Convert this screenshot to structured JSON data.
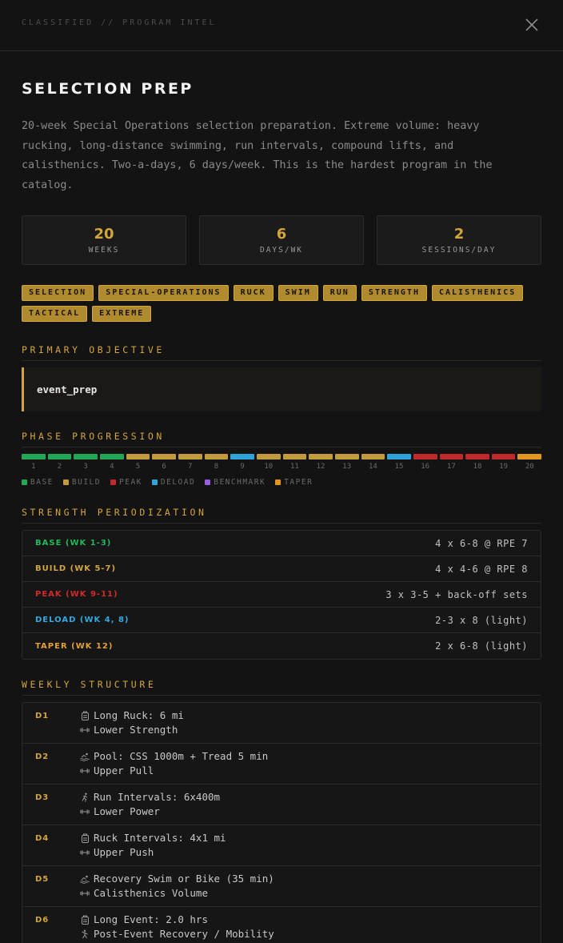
{
  "header": {
    "classified": "CLASSIFIED // PROGRAM INTEL"
  },
  "program": {
    "title": "SELECTION PREP",
    "description": "20-week Special Operations selection preparation. Extreme volume: heavy rucking, long-distance swimming, run intervals, compound lifts, and calisthenics. Two-a-days, 6 days/week. This is the hardest program in the catalog."
  },
  "stats": [
    {
      "value": "20",
      "label": "WEEKS"
    },
    {
      "value": "6",
      "label": "DAYS/WK"
    },
    {
      "value": "2",
      "label": "SESSIONS/DAY"
    }
  ],
  "tags": [
    "SELECTION",
    "SPECIAL-OPERATIONS",
    "RUCK",
    "SWIM",
    "RUN",
    "STRENGTH",
    "CALISTHENICS",
    "TACTICAL",
    "EXTREME"
  ],
  "objective": {
    "title": "PRIMARY OBJECTIVE",
    "value": "event_prep"
  },
  "phases": {
    "title": "PHASE PROGRESSION",
    "weeks": [
      {
        "n": "1",
        "phase": "base"
      },
      {
        "n": "2",
        "phase": "base"
      },
      {
        "n": "3",
        "phase": "base"
      },
      {
        "n": "4",
        "phase": "base"
      },
      {
        "n": "5",
        "phase": "build"
      },
      {
        "n": "6",
        "phase": "build"
      },
      {
        "n": "7",
        "phase": "build"
      },
      {
        "n": "8",
        "phase": "build"
      },
      {
        "n": "9",
        "phase": "deload"
      },
      {
        "n": "10",
        "phase": "build"
      },
      {
        "n": "11",
        "phase": "build"
      },
      {
        "n": "12",
        "phase": "build"
      },
      {
        "n": "13",
        "phase": "build"
      },
      {
        "n": "14",
        "phase": "build"
      },
      {
        "n": "15",
        "phase": "deload"
      },
      {
        "n": "16",
        "phase": "peak"
      },
      {
        "n": "17",
        "phase": "peak"
      },
      {
        "n": "18",
        "phase": "peak"
      },
      {
        "n": "19",
        "phase": "peak"
      },
      {
        "n": "20",
        "phase": "taper"
      }
    ],
    "legend": [
      {
        "key": "base",
        "label": "BASE",
        "color": "#22a855"
      },
      {
        "key": "build",
        "label": "BUILD",
        "color": "#c39a3c"
      },
      {
        "key": "peak",
        "label": "PEAK",
        "color": "#c0282a"
      },
      {
        "key": "deload",
        "label": "DELOAD",
        "color": "#2fa4d8"
      },
      {
        "key": "benchmark",
        "label": "BENCHMARK",
        "color": "#9a5de0"
      },
      {
        "key": "taper",
        "label": "TAPER",
        "color": "#e0971c"
      }
    ]
  },
  "strength": {
    "title": "STRENGTH PERIODIZATION",
    "rows": [
      {
        "label": "BASE (WK 1-3)",
        "value": "4 x 6-8 @ RPE 7",
        "color": "#22b85c"
      },
      {
        "label": "BUILD (WK 5-7)",
        "value": "4 x 4-6 @ RPE 8",
        "color": "#d4a53a"
      },
      {
        "label": "PEAK (WK 9-11)",
        "value": "3 x 3-5 + back-off sets",
        "color": "#d12a2a"
      },
      {
        "label": "DELOAD (WK 4, 8)",
        "value": "2-3 x 8 (light)",
        "color": "#34a9e0"
      },
      {
        "label": "TAPER (WK 12)",
        "value": "2 x 6-8 (light)",
        "color": "#e0a030"
      }
    ]
  },
  "weekly": {
    "title": "WEEKLY STRUCTURE",
    "days": [
      {
        "day": "D1",
        "s1_icon": "backpack-icon",
        "s1": "Long Ruck: 6 mi",
        "s2_icon": "dumbbell-icon",
        "s2": "Lower Strength"
      },
      {
        "day": "D2",
        "s1_icon": "swimmer-icon",
        "s1": "Pool: CSS 1000m + Tread 5 min",
        "s2_icon": "dumbbell-icon",
        "s2": "Upper Pull"
      },
      {
        "day": "D3",
        "s1_icon": "runner-icon",
        "s1": "Run Intervals: 6x400m",
        "s2_icon": "dumbbell-icon",
        "s2": "Lower Power"
      },
      {
        "day": "D4",
        "s1_icon": "backpack-icon",
        "s1": "Ruck Intervals: 4x1 mi",
        "s2_icon": "dumbbell-icon",
        "s2": "Upper Push"
      },
      {
        "day": "D5",
        "s1_icon": "swimmer-icon",
        "s1": "Recovery Swim or Bike (35 min)",
        "s2_icon": "dumbbell-icon",
        "s2": "Calisthenics Volume"
      },
      {
        "day": "D6",
        "s1_icon": "backpack-icon",
        "s1": "Long Event: 2.0 hrs",
        "s2_icon": "stretch-icon",
        "s2": "Post-Event Recovery / Mobility"
      }
    ]
  }
}
